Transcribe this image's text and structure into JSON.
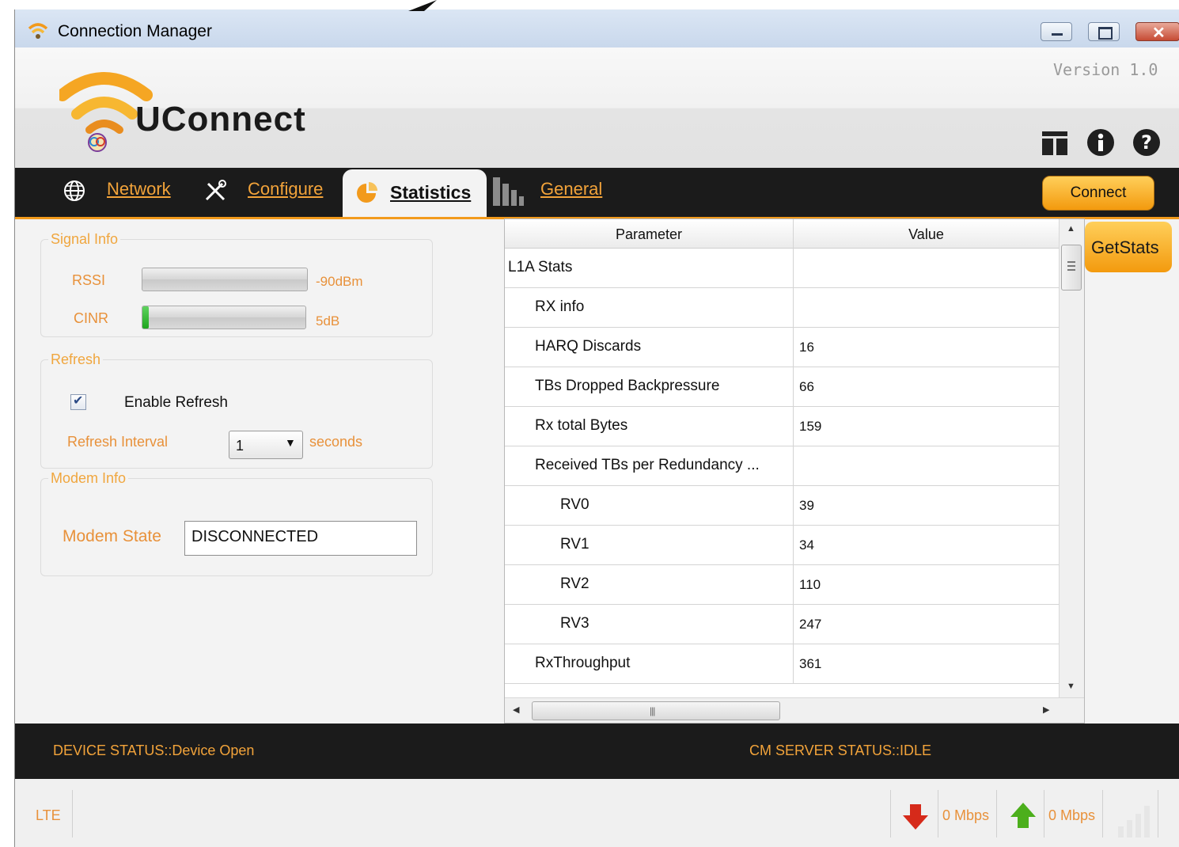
{
  "window": {
    "title": "Connection Manager",
    "icon": "wifi-icon"
  },
  "header": {
    "version": "Version 1.0",
    "brand": "UConnect",
    "icons": [
      "table-icon",
      "info-icon",
      "help-icon"
    ]
  },
  "nav": {
    "tabs": [
      {
        "label": "Network",
        "icon": "globe-icon"
      },
      {
        "label": "Configure",
        "icon": "tools-icon"
      },
      {
        "label": "Statistics",
        "icon": "pie-chart-icon",
        "active": true
      },
      {
        "label": "General",
        "icon": "bars-icon"
      }
    ],
    "connect_label": "Connect"
  },
  "signal": {
    "legend": "Signal Info",
    "rssi_label": "RSSI",
    "rssi_value": "-90dBm",
    "rssi_level": 0,
    "cinr_label": "CINR",
    "cinr_value": "5dB",
    "cinr_level": 0.04
  },
  "refresh": {
    "legend": "Refresh",
    "enable_label": "Enable Refresh",
    "enabled": true,
    "interval_label": "Refresh Interval",
    "interval_value": "1",
    "interval_unit": "seconds"
  },
  "modem": {
    "legend": "Modem Info",
    "state_label": "Modem State",
    "state_value": "DISCONNECTED"
  },
  "getstats_label": "GetStats",
  "table": {
    "headers": [
      "Parameter",
      "Value"
    ],
    "rows": [
      {
        "param": "L1A Stats",
        "value": "",
        "level": 0
      },
      {
        "param": "RX info",
        "value": "",
        "level": 1
      },
      {
        "param": "HARQ Discards",
        "value": "16",
        "level": 1
      },
      {
        "param": "TBs Dropped Backpressure",
        "value": "66",
        "level": 1
      },
      {
        "param": "Rx total Bytes",
        "value": "159",
        "level": 1
      },
      {
        "param": "Received TBs per Redundancy ...",
        "value": "",
        "level": 1
      },
      {
        "param": "RV0",
        "value": "39",
        "level": 2
      },
      {
        "param": "RV1",
        "value": "34",
        "level": 2
      },
      {
        "param": "RV2",
        "value": "110",
        "level": 2
      },
      {
        "param": "RV3",
        "value": "247",
        "level": 2
      },
      {
        "param": "RxThroughput",
        "value": "361",
        "level": 1
      }
    ]
  },
  "status": {
    "device": "DEVICE STATUS::Device Open",
    "server": "CM SERVER STATUS::IDLE"
  },
  "bottom": {
    "network_type": "LTE",
    "download": "0 Mbps",
    "upload": "0 Mbps"
  },
  "colors": {
    "accent": "#f29a1c",
    "label": "#e8913a",
    "dark": "#1b1b1b"
  }
}
